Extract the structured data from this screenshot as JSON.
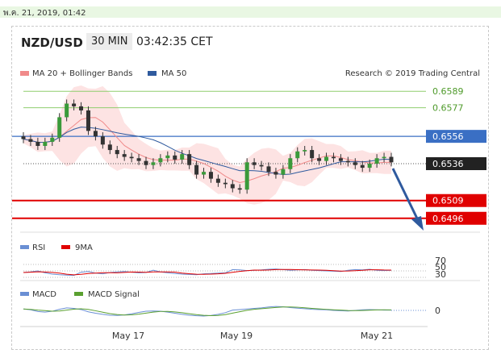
{
  "timestamp": "พ.ค. 21, 2019, 01:42",
  "header": {
    "pair": "NZD/USD",
    "timeframe": "30 MIN",
    "clock": "03:42:35 CET"
  },
  "credit": "Research © 2019 Trading Central",
  "legend": {
    "bb": "MA 20 + Bollinger Bands",
    "ma50": "MA 50",
    "rsi": "RSI",
    "rsi_ma": "9MA",
    "macd": "MACD",
    "macd_signal": "MACD Signal"
  },
  "levels": [
    {
      "label": "0.6589",
      "value": 0.6589,
      "style": "green"
    },
    {
      "label": "0.6577",
      "value": 0.6577,
      "style": "green"
    },
    {
      "label": "0.6556",
      "value": 0.6556,
      "style": "blue"
    },
    {
      "label": "0.6536",
      "value": 0.6536,
      "style": "current"
    },
    {
      "label": "0.6509",
      "value": 0.6509,
      "style": "red"
    },
    {
      "label": "0.6496",
      "value": 0.6496,
      "style": "red"
    }
  ],
  "rsi_levels": [
    "70",
    "50",
    "30"
  ],
  "macd_zero": "0",
  "x_labels": [
    "May 17",
    "May 19",
    "May 21"
  ],
  "colors": {
    "green": "#8fce6e",
    "blue": "#3a6fc4",
    "red": "#e00000",
    "current": "#222222",
    "bb": "#f08a8a",
    "ma50": "#2f5a9e",
    "arrow": "#2f5a9e"
  },
  "chart_data": {
    "type": "candlestick",
    "y_range": [
      0.6487,
      0.6598
    ],
    "close": [
      0.6554,
      0.6552,
      0.6549,
      0.6552,
      0.6555,
      0.657,
      0.658,
      0.6578,
      0.6575,
      0.656,
      0.6556,
      0.655,
      0.6546,
      0.6543,
      0.6541,
      0.654,
      0.6538,
      0.6535,
      0.6537,
      0.654,
      0.6542,
      0.6539,
      0.6543,
      0.6535,
      0.6528,
      0.653,
      0.6525,
      0.6522,
      0.6521,
      0.6518,
      0.6517,
      0.6537,
      0.6535,
      0.6534,
      0.653,
      0.6528,
      0.6532,
      0.654,
      0.6545,
      0.6546,
      0.654,
      0.6538,
      0.6541,
      0.654,
      0.6538,
      0.6537,
      0.6535,
      0.6533,
      0.6536,
      0.654,
      0.6541,
      0.6537
    ],
    "rsi": [
      45,
      47,
      50,
      44,
      40,
      38,
      37,
      36,
      46,
      48,
      43,
      41,
      45,
      47,
      48,
      46,
      44,
      45,
      52,
      47,
      44,
      42,
      40,
      39,
      38,
      41,
      42,
      43,
      44,
      54,
      53,
      51,
      52,
      53,
      55,
      56,
      54,
      52,
      53,
      54,
      52,
      51,
      50,
      49,
      48,
      52,
      54,
      53,
      55,
      52,
      51,
      52
    ],
    "macd": [
      0.5,
      0.2,
      -0.4,
      -0.6,
      -0.3,
      0.4,
      0.9,
      0.7,
      0.3,
      -0.5,
      -1.0,
      -1.4,
      -1.7,
      -1.8,
      -1.6,
      -1.2,
      -0.7,
      -0.3,
      -0.2,
      -0.3,
      -0.6,
      -1.0,
      -1.4,
      -1.7,
      -1.9,
      -2.0,
      -1.8,
      -1.4,
      -0.8,
      0.1,
      0.3,
      0.5,
      0.7,
      0.9,
      1.2,
      1.4,
      1.3,
      1.0,
      0.8,
      0.6,
      0.4,
      0.3,
      0.2,
      0.0,
      -0.1,
      -0.2,
      0.0,
      0.2,
      0.3,
      0.2,
      0.1,
      0.1
    ]
  }
}
